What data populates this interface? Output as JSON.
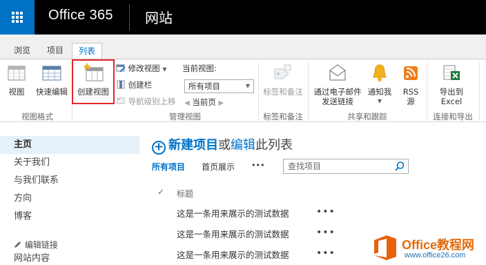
{
  "suitebar": {
    "brand": "Office 365",
    "site_title": "网站"
  },
  "tabs": [
    {
      "label": "浏览"
    },
    {
      "label": "项目"
    },
    {
      "label": "列表"
    }
  ],
  "ribbon": {
    "view_format": {
      "label": "视图格式",
      "view": "视图",
      "quick_edit": "快速编辑"
    },
    "manage_views": {
      "label": "管理视图",
      "create_view": "创建视图",
      "modify_view": "修改视图",
      "create_column": "创建栏",
      "navigate_up": "导航级别上移",
      "current_view_label": "当前视图:",
      "current_view_value": "所有项目",
      "current_page": "当前页"
    },
    "tags": {
      "label": "标签和备注",
      "tags_notes": "标签和备注"
    },
    "share": {
      "label": "共享和跟踪",
      "email_link_1": "通过电子邮件",
      "email_link_2": "发送链接",
      "alert_me": "通知我",
      "rss_1": "RSS",
      "rss_2": "源"
    },
    "connect": {
      "label": "连接和导出",
      "export_1": "导出到",
      "export_2": "Excel"
    }
  },
  "leftnav": {
    "items": [
      {
        "label": "主页"
      },
      {
        "label": "关于我们"
      },
      {
        "label": "与我们联系"
      },
      {
        "label": "方向"
      },
      {
        "label": "博客"
      }
    ],
    "edit_links": "编辑链接",
    "site_contents": "网站内容"
  },
  "main": {
    "new_item": "新建项目",
    "or": "或",
    "edit": "编辑",
    "this_list": "此列表",
    "views": [
      {
        "label": "所有项目"
      },
      {
        "label": "首页展示"
      }
    ],
    "more": "•••",
    "search_placeholder": "查找项目",
    "column_title": "标题",
    "check": "✓",
    "rows": [
      {
        "title": "这是一条用来展示的测试数据"
      },
      {
        "title": "这是一条用来展示的测试数据"
      },
      {
        "title": "这是一条用来展示的测试数据"
      }
    ]
  },
  "watermark": {
    "name": "Office教程网",
    "url": "www.office26.com"
  },
  "colors": {
    "accent": "#0072c6",
    "highlight": "#e5242a"
  }
}
